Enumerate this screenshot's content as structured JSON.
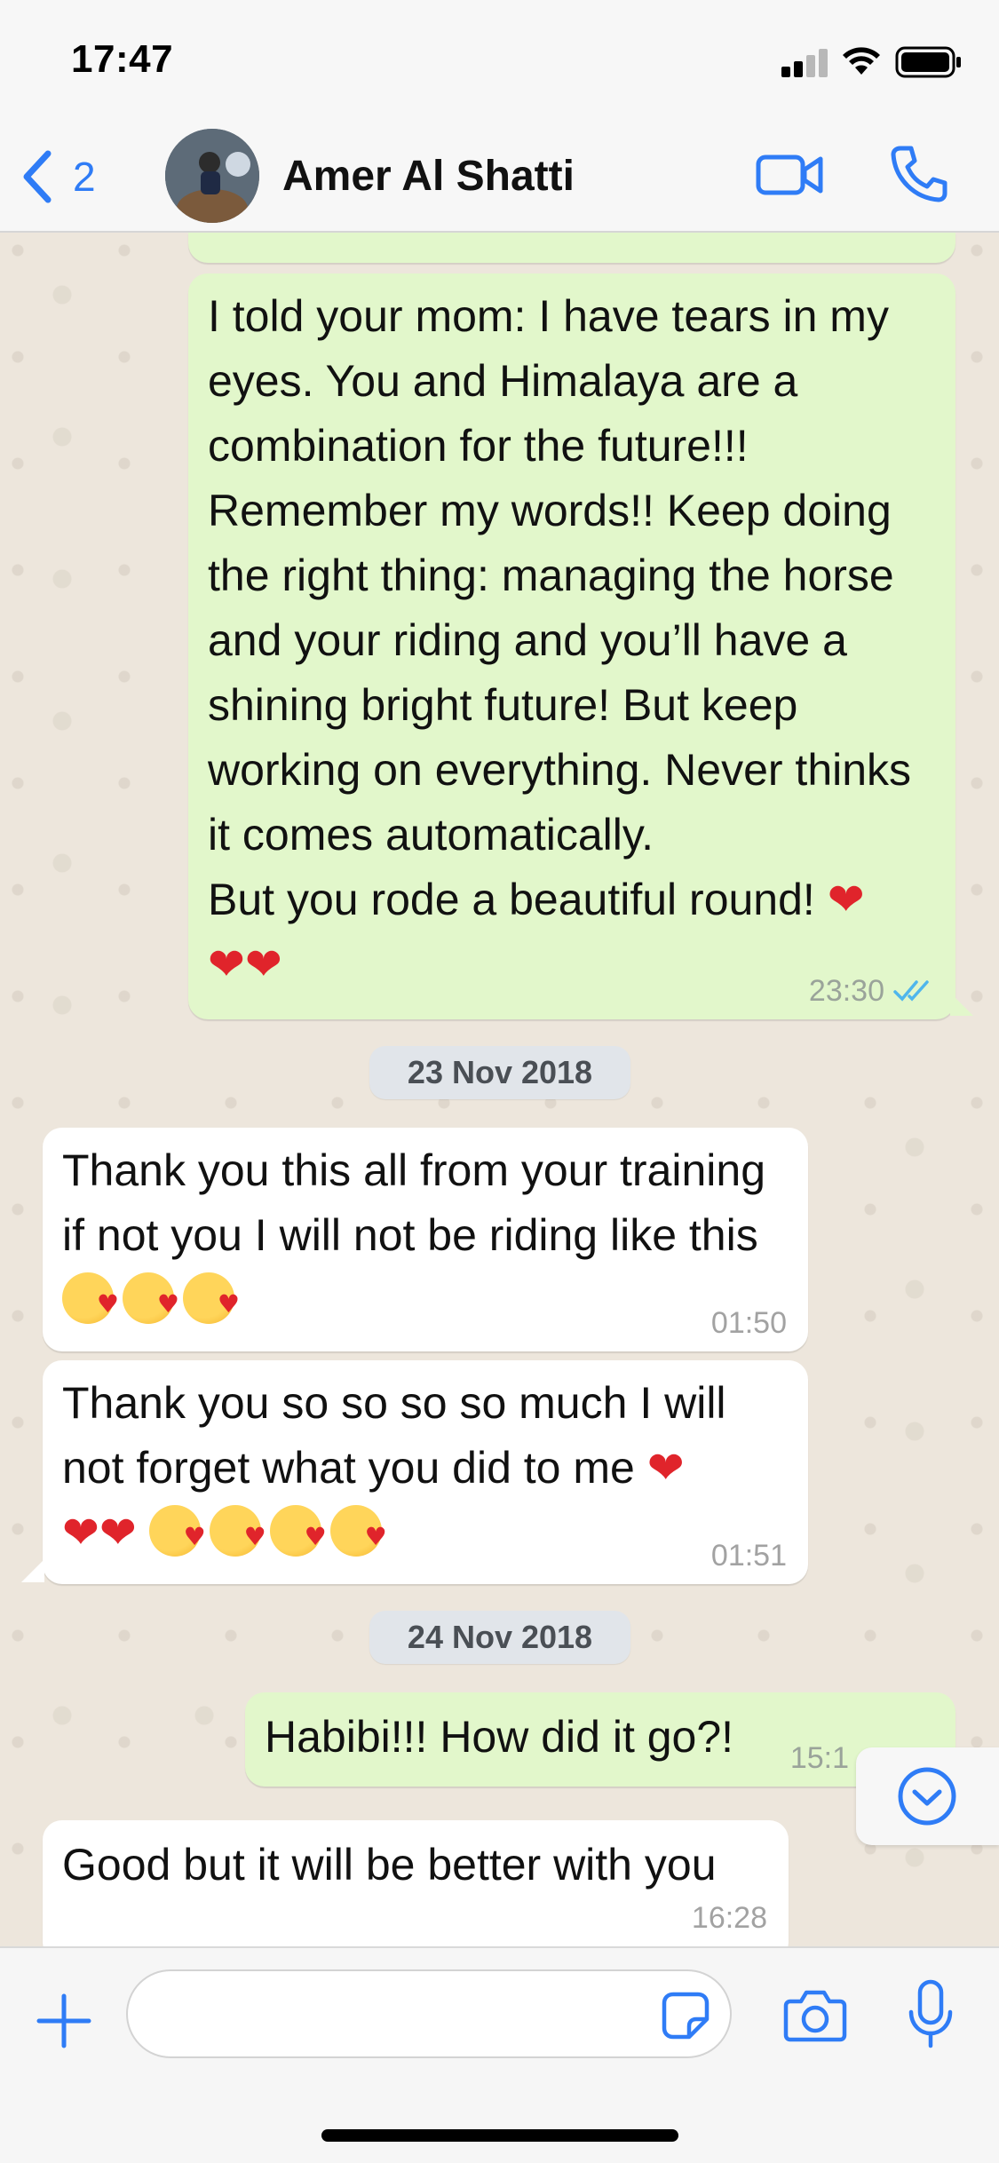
{
  "status_bar": {
    "time": "17:47"
  },
  "header": {
    "back_count": "2",
    "contact_name": "Amer Al Shatti"
  },
  "messages": [
    {
      "direction": "out",
      "text_lines": [
        "I told your mom: I have tears in my",
        "eyes. You and Himalaya are a",
        "combination for the future!!!",
        "Remember my words!! Keep doing",
        "the right thing: managing the horse",
        "and your riding and you’ll have a",
        "shining bright future! But keep",
        "working on everything. Never thinks",
        "it comes automatically.",
        "But you rode a beautiful round!"
      ],
      "emoji": "❤️❤️❤️",
      "time": "23:30",
      "read_status": "double-check-icon"
    },
    {
      "direction": "in",
      "text_lines": [
        "Thank you this all from your training",
        "if not you I will not be riding like this"
      ],
      "emoji": "😘😘😘",
      "time": "01:50"
    },
    {
      "direction": "in",
      "text_lines": [
        "Thank you so so so so much I will",
        "not forget what you did to me"
      ],
      "emoji": "❤️❤️❤️😘😘😘😘",
      "time": "01:51"
    },
    {
      "direction": "out",
      "text_lines": [
        "Habibi!!! How did it go?!"
      ],
      "time": "15:1"
    },
    {
      "direction": "in",
      "text_lines": [
        "Good but it will be better with you"
      ],
      "time": "16:28"
    }
  ],
  "date_pills": [
    "23 Nov 2018",
    "24 Nov 2018"
  ],
  "colors": {
    "accent": "#2f7cf6",
    "outgoing_bubble": "#e2f7cb",
    "incoming_bubble": "#ffffff",
    "heart": "#e0242b",
    "read_tick": "#4fb6ec"
  },
  "icons": {
    "back": "chevron-left-icon",
    "video": "video-camera-icon",
    "call": "phone-icon",
    "scroll_down": "chevron-down-circle-icon",
    "attach": "plus-icon",
    "sticker": "sticker-icon",
    "camera": "camera-icon",
    "mic": "microphone-icon"
  }
}
